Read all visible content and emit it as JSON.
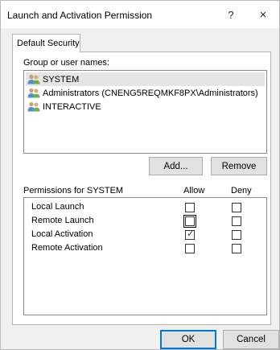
{
  "window": {
    "title": "Launch and Activation Permission",
    "help_label": "?",
    "close_label": "×"
  },
  "tab": {
    "label": "Default Security"
  },
  "group": {
    "label": "Group or user names:",
    "items": [
      {
        "label": "SYSTEM",
        "icon": "users-icon",
        "selected": true
      },
      {
        "label": "Administrators (CNENG5REQMKF8PX\\Administrators)",
        "icon": "users-icon",
        "selected": false
      },
      {
        "label": "INTERACTIVE",
        "icon": "users-icon",
        "selected": false
      }
    ]
  },
  "buttons": {
    "add": "Add...",
    "remove": "Remove",
    "ok": "OK",
    "cancel": "Cancel"
  },
  "permissions": {
    "title": "Permissions for SYSTEM",
    "allow_header": "Allow",
    "deny_header": "Deny",
    "rows": [
      {
        "name": "Local Launch",
        "allow": false,
        "deny": false
      },
      {
        "name": "Remote Launch",
        "allow": false,
        "deny": false
      },
      {
        "name": "Local Activation",
        "allow": true,
        "deny": false
      },
      {
        "name": "Remote Activation",
        "allow": false,
        "deny": false
      }
    ]
  },
  "colors": {
    "accent": "#0078d7",
    "selection": "#e5e5e5"
  }
}
